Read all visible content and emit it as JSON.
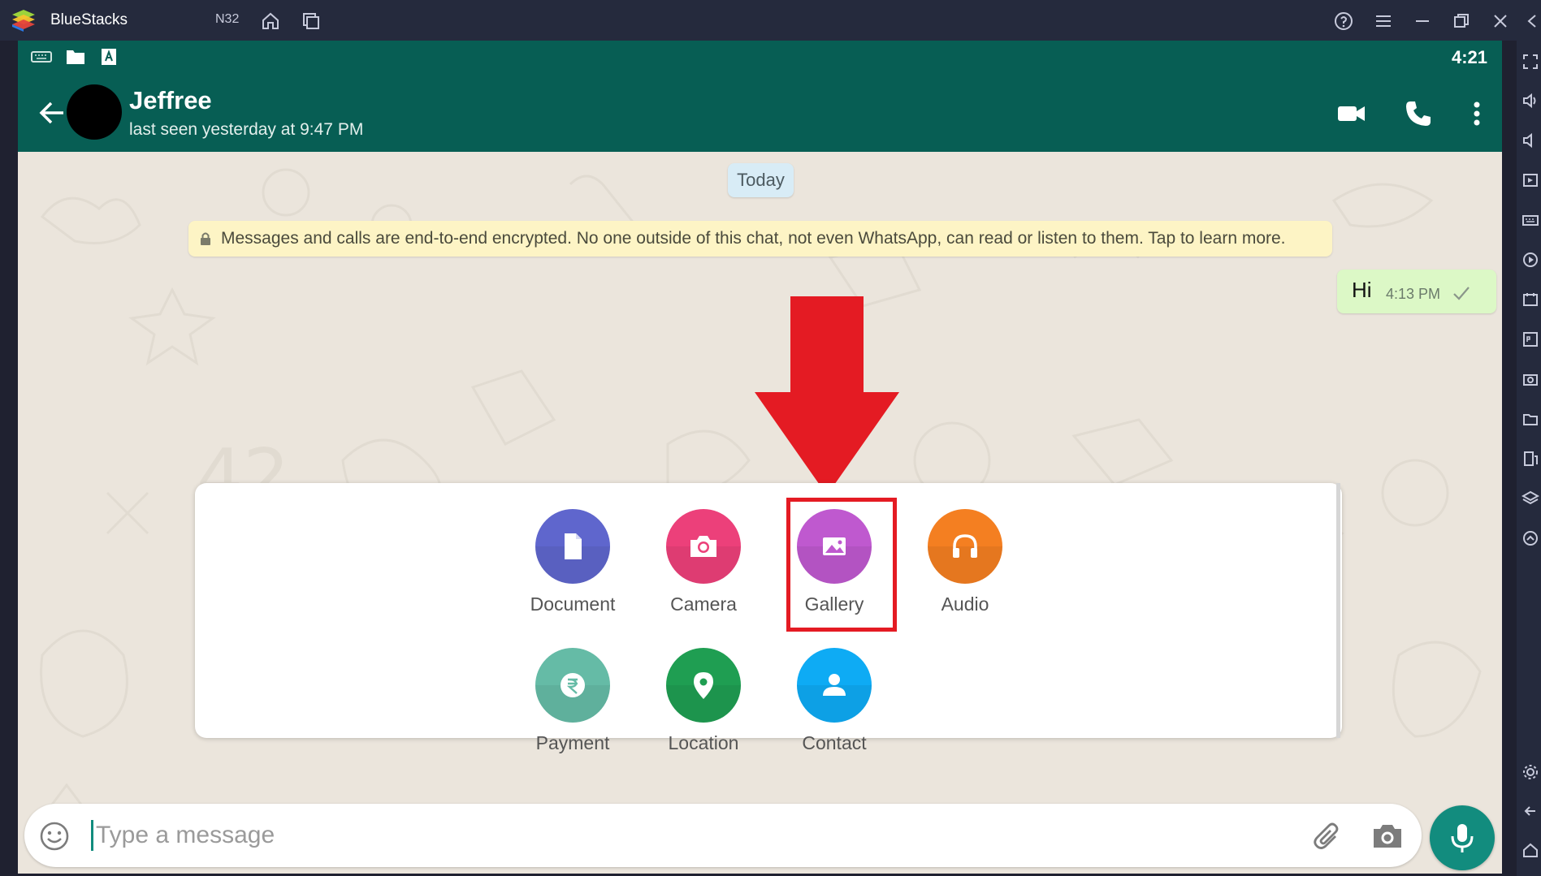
{
  "bluestacks": {
    "title": "BlueStacks",
    "instance": "N32"
  },
  "statusbar": {
    "time": "4:21"
  },
  "chat_header": {
    "contact_name": "Jeffree",
    "last_seen": "last seen yesterday at 9:47 PM"
  },
  "chat": {
    "date_chip": "Today",
    "encryption_notice": "Messages and calls are end-to-end encrypted. No one outside of this chat, not even WhatsApp, can read or listen to them. Tap to learn more.",
    "messages": [
      {
        "text": "Hi",
        "time": "4:13 PM",
        "status": "sent"
      }
    ]
  },
  "attach_menu": {
    "items": [
      {
        "label": "Document",
        "color": "#5f66cd",
        "icon": "document-icon"
      },
      {
        "label": "Camera",
        "color": "#ec407a",
        "icon": "camera-icon"
      },
      {
        "label": "Gallery",
        "color": "#bf59cf",
        "icon": "gallery-icon",
        "highlighted": true
      },
      {
        "label": "Audio",
        "color": "#f47f21",
        "icon": "headphones-icon"
      },
      {
        "label": "Payment",
        "color": "#65bba6",
        "icon": "rupee-icon"
      },
      {
        "label": "Location",
        "color": "#1f9e52",
        "icon": "location-pin-icon"
      },
      {
        "label": "Contact",
        "color": "#0eabf4",
        "icon": "person-icon"
      }
    ]
  },
  "input": {
    "placeholder": "Type a message"
  },
  "colors": {
    "header": "#075e54",
    "accent": "#128c7e",
    "annotation": "#e41b23",
    "outgoing_bubble": "#dcf8c6"
  }
}
